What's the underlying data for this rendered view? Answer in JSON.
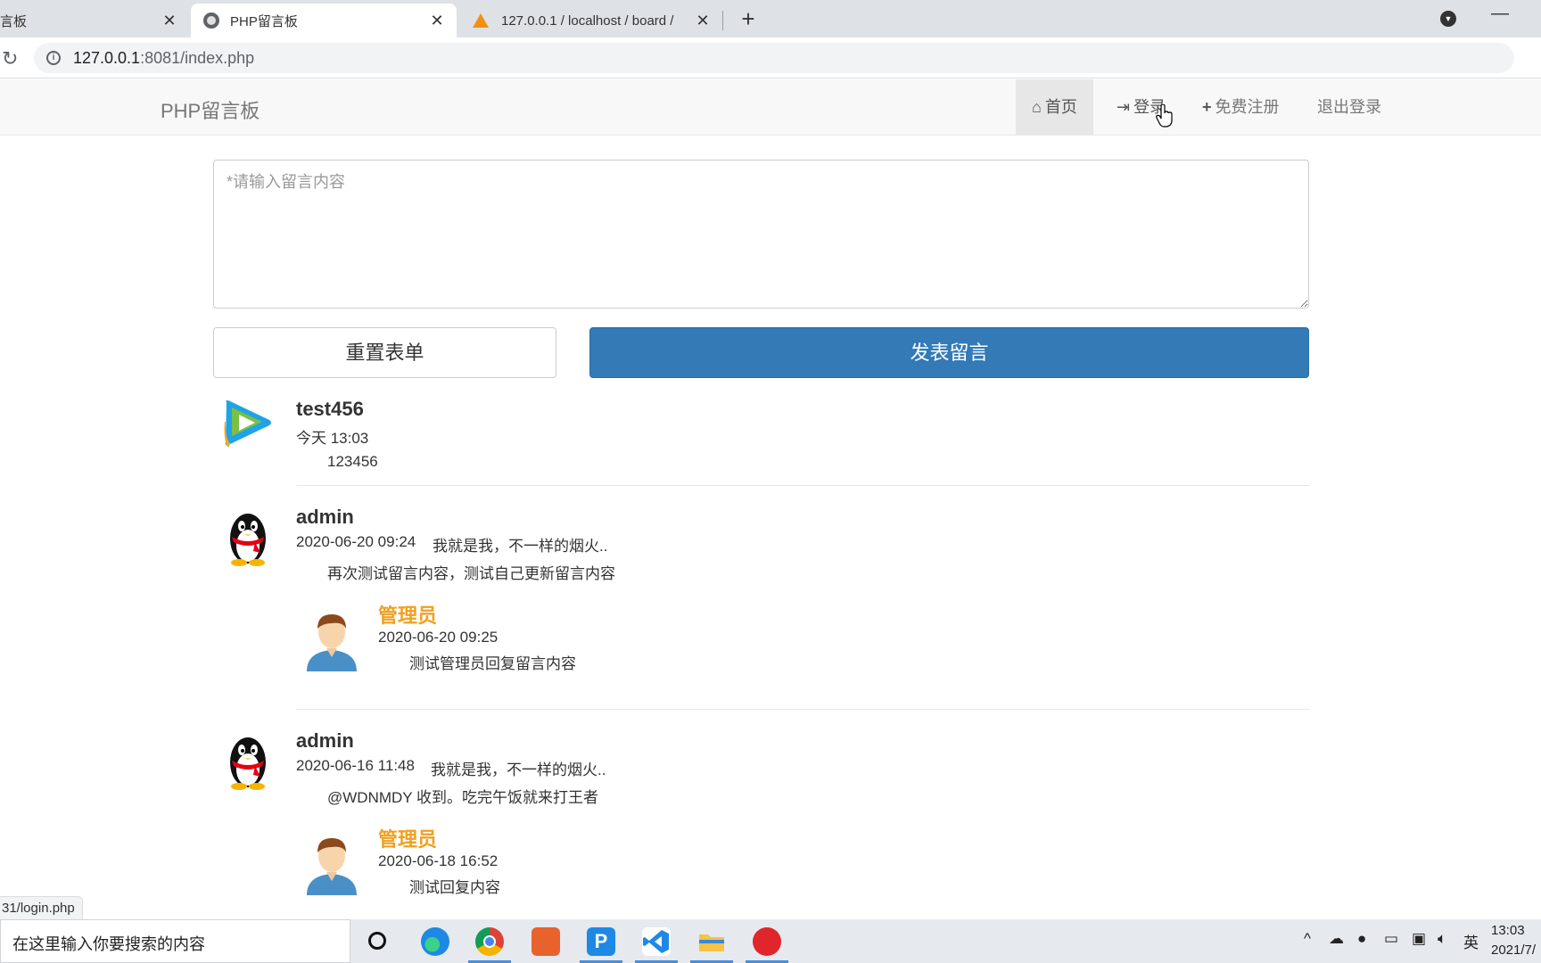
{
  "browser": {
    "tabs": [
      {
        "title": "言板",
        "close": "✕"
      },
      {
        "title": "PHP留言板",
        "close": "✕"
      },
      {
        "title": "127.0.0.1 / localhost / board /",
        "close": "✕"
      }
    ],
    "new_tab": "+",
    "url_host": "127.0.0.1",
    "url_rest": ":8081/index.php",
    "status_url": "31/login.php"
  },
  "navbar": {
    "brand": "PHP留言板",
    "items": [
      {
        "icon": "home-icon",
        "label": "首页"
      },
      {
        "icon": "login-icon",
        "label": "登录"
      },
      {
        "icon": "plus-icon",
        "label": "免费注册"
      },
      {
        "label": "退出登录"
      }
    ]
  },
  "form": {
    "placeholder": "*请输入留言内容",
    "value": "",
    "reset_label": "重置表单",
    "submit_label": "发表留言"
  },
  "messages": [
    {
      "user": "test456",
      "time": "今天 13:03",
      "signature": "",
      "content": "123456",
      "avatar": "tencent-video-avatar"
    },
    {
      "user": "admin",
      "time": "2020-06-20 09:24",
      "signature": "我就是我，不一样的烟火..",
      "content": "再次测试留言内容，测试自己更新留言内容",
      "avatar": "qq-penguin-avatar",
      "reply": {
        "user": "管理员",
        "time": "2020-06-20 09:25",
        "content": "测试管理员回复留言内容"
      }
    },
    {
      "user": "admin",
      "time": "2020-06-16 11:48",
      "signature": "我就是我，不一样的烟火..",
      "content": "@WDNMDY 收到。吃完午饭就来打王者",
      "avatar": "qq-penguin-avatar",
      "reply": {
        "user": "管理员",
        "time": "2020-06-18 16:52",
        "content": "测试回复内容"
      }
    }
  ],
  "taskbar": {
    "search_placeholder": "在这里输入你要搜索的内容",
    "tray_lang": "英",
    "clock_time": "13:03",
    "clock_date": "2021/7/"
  },
  "colors": {
    "primary": "#337ab7",
    "reply_name": "#f0a020",
    "navbar_bg": "#f8f8f8"
  }
}
